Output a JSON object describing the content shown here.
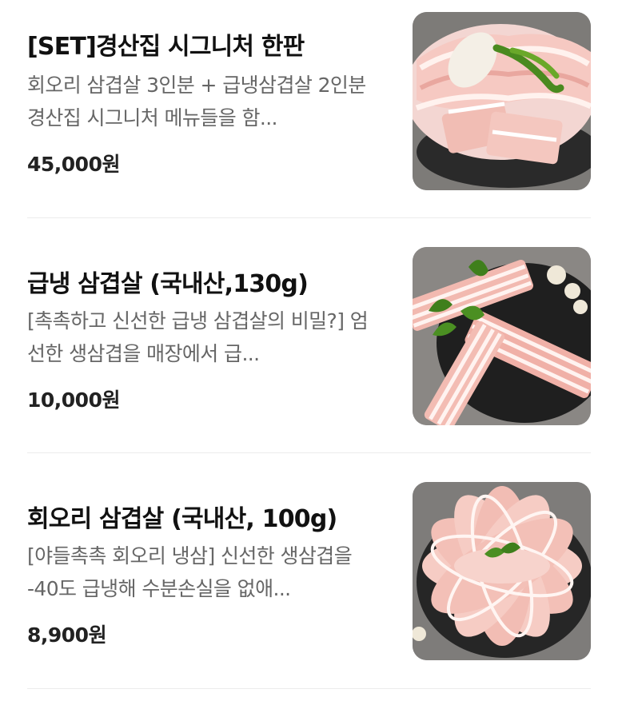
{
  "menu": {
    "items": [
      {
        "title": "[SET]경산집 시그니처 한판",
        "description": "회오리 삼겹살 3인분 + 급냉삼겹살 2인분 경산집 시그니처 메뉴들을 함...",
        "price": "45,000원",
        "image": "pork-belly-set-platter-photo"
      },
      {
        "title": "급냉 삼겹살 (국내산,130g)",
        "description": "[촉촉하고 신선한 급냉 삼겹살의 비밀?] 엄선한 생삼겹을 매장에서 급...",
        "price": "10,000원",
        "image": "frozen-pork-belly-photo"
      },
      {
        "title": "회오리 삼겹살 (국내산, 100g)",
        "description": "[야들촉촉 회오리 냉삼] 신선한 생삼겹을 -40도 급냉해 수분손실을 없애...",
        "price": "8,900원",
        "image": "swirl-pork-belly-photo"
      }
    ]
  }
}
